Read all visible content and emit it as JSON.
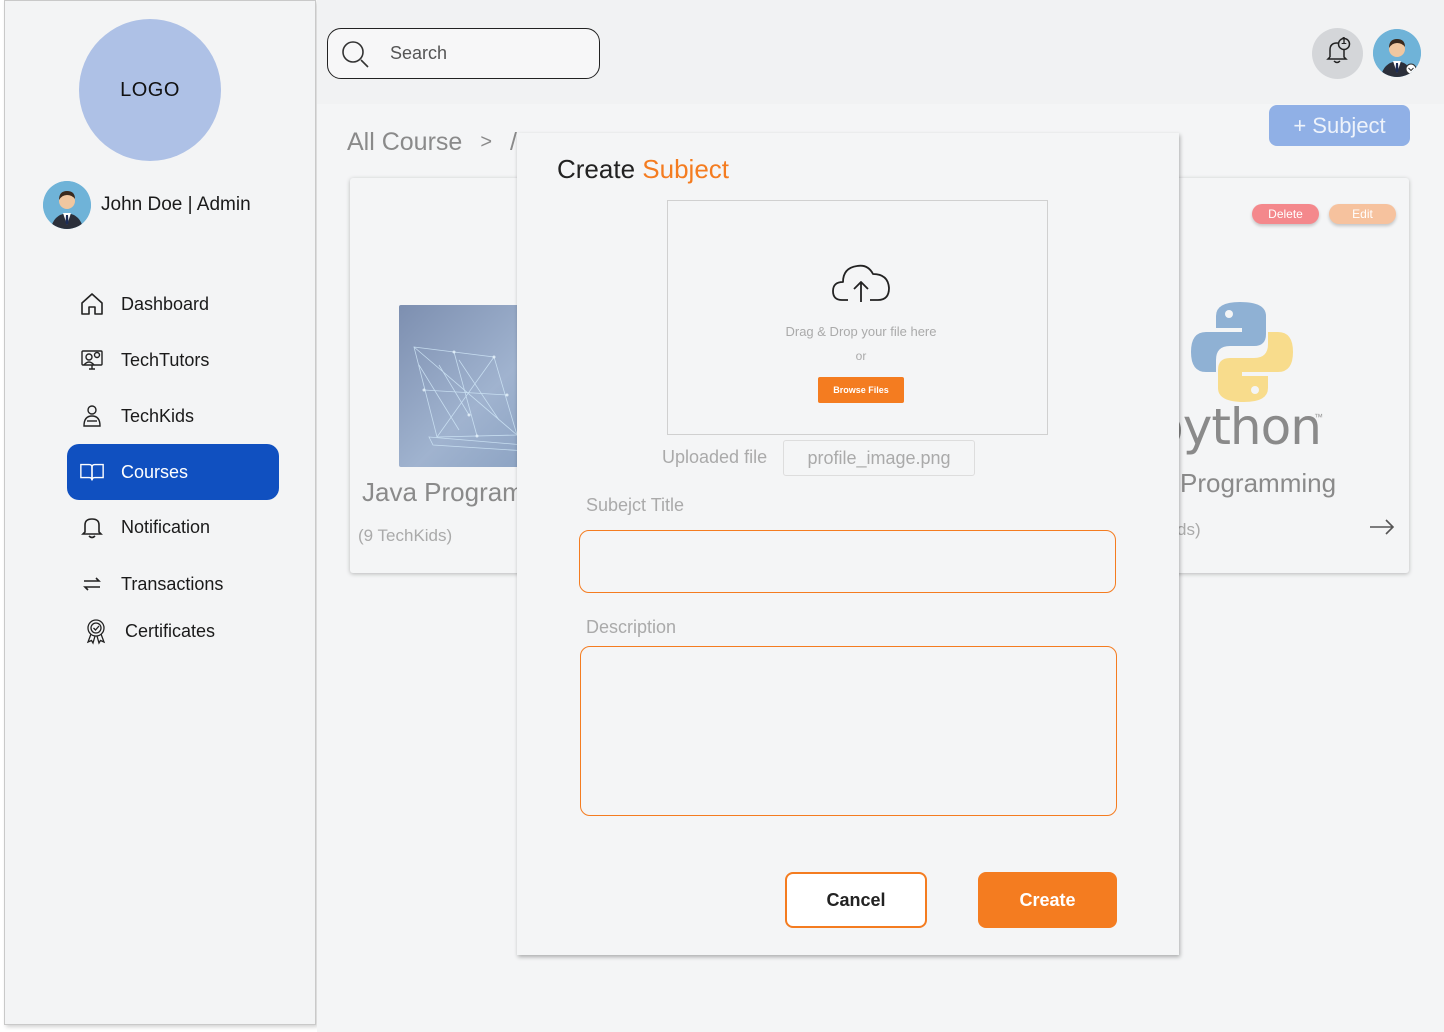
{
  "sidebar": {
    "logo_text": "LOGO",
    "user_label": "John Doe | Admin",
    "nav": [
      {
        "label": "Dashboard",
        "icon": "home-icon"
      },
      {
        "label": "TechTutors",
        "icon": "tutor-icon"
      },
      {
        "label": "TechKids",
        "icon": "kid-icon"
      },
      {
        "label": "Courses",
        "icon": "book-icon",
        "active": true
      },
      {
        "label": "Notification",
        "icon": "bell-icon"
      },
      {
        "label": "Transactions",
        "icon": "transfer-icon"
      },
      {
        "label": "Certificates",
        "icon": "award-icon"
      }
    ]
  },
  "topbar": {
    "search_placeholder": "Search",
    "notification_count": "1"
  },
  "main": {
    "breadcrumb_root": "All Course",
    "breadcrumb_sep": ">",
    "breadcrumb_current": "/",
    "add_subject_label": "+ Subject",
    "card_left": {
      "title": "Java Program",
      "meta": "(9 TechKids)"
    },
    "card_right": {
      "delete_label": "Delete",
      "edit_label": "Edit",
      "logo_word": "python",
      "logo_tm": "™",
      "title": "Programming",
      "meta": "ds)"
    }
  },
  "modal": {
    "title_plain": "Create",
    "title_accent": "Subject",
    "drag_text": "Drag & Drop your file here",
    "or_text": "or",
    "browse_label": "Browse Files",
    "uploaded_label": "Uploaded file",
    "uploaded_file": "profile_image.png",
    "subject_title_label": "Subejct Title",
    "subject_title_value": "",
    "description_label": "Description",
    "description_value": "",
    "cancel_label": "Cancel",
    "create_label": "Create"
  },
  "colors": {
    "accent": "#f47c20",
    "nav_active": "#1050c0",
    "logo_bg": "#aec1e6",
    "add_subject_bg": "#90b0e6",
    "delete_pill": "#f4888c",
    "edit_pill": "#f6c29e"
  }
}
